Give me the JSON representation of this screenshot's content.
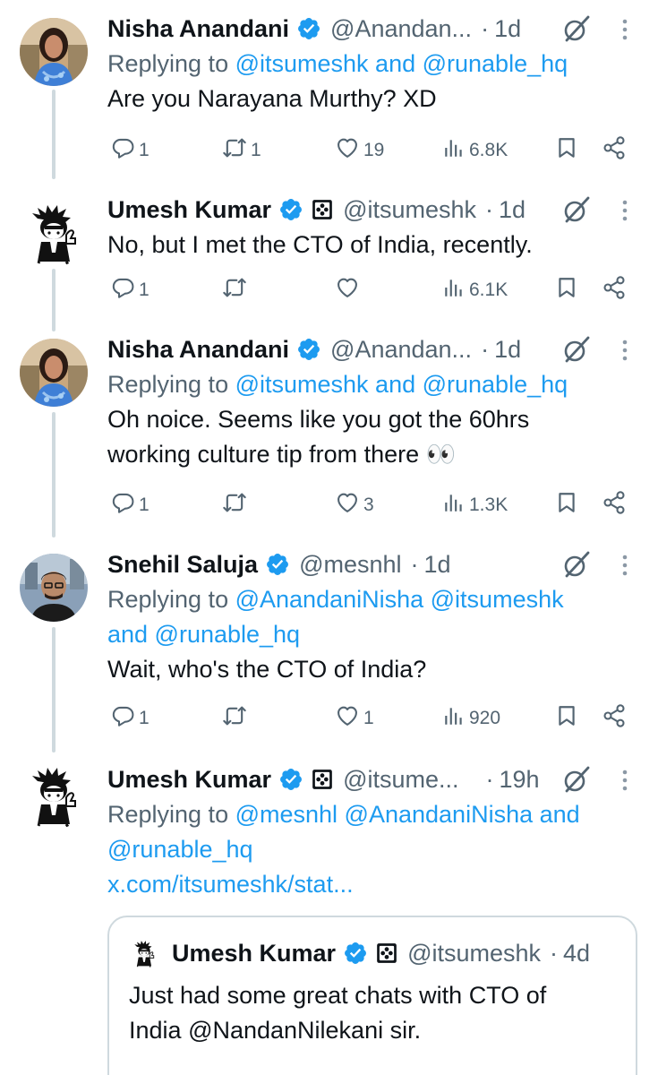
{
  "tweets": [
    {
      "name": "Nisha Anandani",
      "handle": "@Anandan...",
      "dot": "·",
      "time": "1d",
      "replying_label": "Replying to",
      "reply_mentions": "@itsumeshk and @runable_hq",
      "text": "Are you Narayana Murthy? XD",
      "replies": "1",
      "reposts": "1",
      "likes": "19",
      "views": "6.8K"
    },
    {
      "name": "Umesh Kumar",
      "handle": "@itsumeshk",
      "dot": "·",
      "time": "1d",
      "text": "No, but I met the CTO of India, recently.",
      "replies": "1",
      "reposts": "",
      "likes": "",
      "views": "6.1K"
    },
    {
      "name": "Nisha Anandani",
      "handle": "@Anandan...",
      "dot": "·",
      "time": "1d",
      "replying_label": "Replying to",
      "reply_mentions": "@itsumeshk and @runable_hq",
      "text_line1": "Oh noice. Seems like you got the 60hrs",
      "text_line2": "working culture tip from there 👀",
      "replies": "1",
      "reposts": "",
      "likes": "3",
      "views": "1.3K"
    },
    {
      "name": "Snehil Saluja",
      "handle": "@mesnhl",
      "dot": "·",
      "time": "1d",
      "replying_label": "Replying to",
      "reply_mentions_line1": "@AnandaniNisha @itsumeshk",
      "reply_mentions_line2": "and @runable_hq",
      "text": "Wait, who's the CTO of India?",
      "replies": "1",
      "reposts": "",
      "likes": "1",
      "views": "920"
    },
    {
      "name": "Umesh Kumar",
      "handle": "@itsume...",
      "dot": "·",
      "time": "19h",
      "replying_label": "Replying to",
      "reply_mentions_line1": "@mesnhl @AnandaniNisha and",
      "reply_mentions_line2": "@runable_hq",
      "link": "x.com/itsumeshk/stat..."
    }
  ],
  "quote": {
    "name": "Umesh Kumar",
    "handle": "@itsumeshk",
    "dot": "·",
    "time": "4d",
    "text_line1": "Just had some great chats with CTO of",
    "text_line2_prefix": "India ",
    "text_line2_mention": "@NandanNilekani",
    "text_line2_suffix": " sir."
  },
  "icons": {
    "reply": "speech-bubble-icon",
    "repost": "repost-arrows-icon",
    "like": "heart-icon",
    "views": "bar-chart-icon",
    "bookmark": "bookmark-icon",
    "share": "share-icon",
    "verified": "verified-badge-icon",
    "grok": "grok-icon",
    "more": "more-vertical-icon"
  },
  "colors": {
    "accent": "#1d9bf0",
    "secondary_text": "#536471",
    "thread_line": "#cfd9de"
  }
}
